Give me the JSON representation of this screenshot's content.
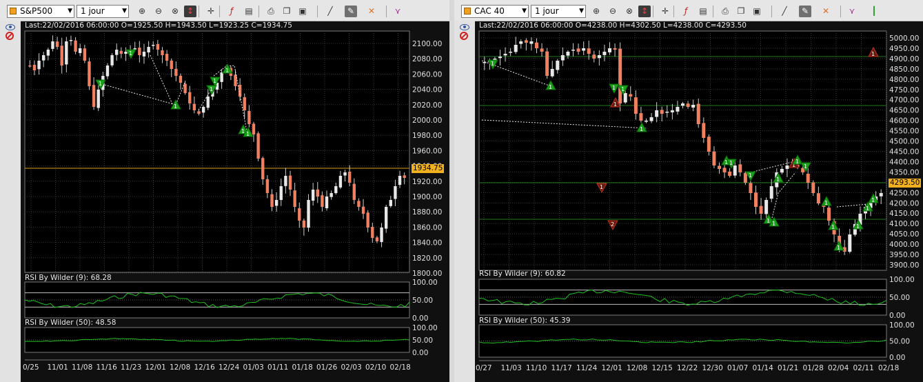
{
  "left": {
    "symbol": "S&P500",
    "period": "1 jour",
    "last_info": "Last:22/02/2016 06:00:00 O=1925.50 H=1943.50 L=1923.25 C=1934.75",
    "price_badge": "1934.75",
    "price_axis": [
      "2100.00",
      "2080.00",
      "2060.00",
      "2040.00",
      "2020.00",
      "2000.00",
      "1980.00",
      "1960.00",
      "1940.00",
      "1920.00",
      "1900.00",
      "1880.00",
      "1860.00",
      "1840.00",
      "1820.00",
      "1800.00"
    ],
    "rsi1_label": "RSI By Wilder (9): 68.28",
    "rsi2_label": "RSI By Wilder (50): 48.58",
    "rsi_axis": [
      "100.00",
      "50.00",
      "0.00"
    ],
    "date_axis": [
      "0/25",
      "11/01",
      "11/08",
      "11/16",
      "11/23",
      "12/01",
      "12/08",
      "12/16",
      "12/24",
      "01/03",
      "01/11",
      "01/18",
      "01/26",
      "02/03",
      "02/10",
      "02/18"
    ]
  },
  "right": {
    "symbol": "CAC 40",
    "period": "1 jour",
    "last_info": "Last:22/02/2016 06:00:00 O=4238.00 H=4302.50 L=4238.00 C=4293.50",
    "price_badge": "4293.50",
    "price_axis": [
      "5000.00",
      "4950.00",
      "4900.00",
      "4850.00",
      "4800.00",
      "4750.00",
      "4700.00",
      "4650.00",
      "4600.00",
      "4550.00",
      "4500.00",
      "4450.00",
      "4400.00",
      "4350.00",
      "4300.00",
      "4250.00",
      "4200.00",
      "4150.00",
      "4100.00",
      "4050.00",
      "4000.00",
      "3950.00",
      "3900.00"
    ],
    "rsi1_label": "RSI By Wilder (9): 60.82",
    "rsi2_label": "RSI By Wilder (50): 45.39",
    "rsi_axis": [
      "100.00",
      "50.00",
      "0.00"
    ],
    "date_axis": [
      "0/27",
      "11/03",
      "11/10",
      "11/17",
      "11/24",
      "12/01",
      "12/08",
      "12/15",
      "12/22",
      "12/30",
      "01/07",
      "01/14",
      "01/21",
      "01/28",
      "02/04",
      "02/11",
      "02/18"
    ]
  },
  "toolbar_icons": [
    "zoom-in-icon",
    "zoom-out-icon",
    "zoom-reset-icon",
    "cursor-tool-icon",
    "crosshair-icon",
    "indicator-f00-icon",
    "template-icon",
    "print-icon",
    "copy-icon",
    "save-icon",
    "trendline-icon",
    "pencil-icon",
    "delete-drawing-icon",
    "pattern-tool-icon",
    "candle-style-icon"
  ],
  "colors": {
    "up_candle": "#e8e8e8",
    "down_candle": "#f08060",
    "grid": "#3a3a3a",
    "price_line": "#d9a020",
    "rsi_line": "#20c020",
    "signal_up": "#1aa01a",
    "signal_down": "#c03020"
  }
}
